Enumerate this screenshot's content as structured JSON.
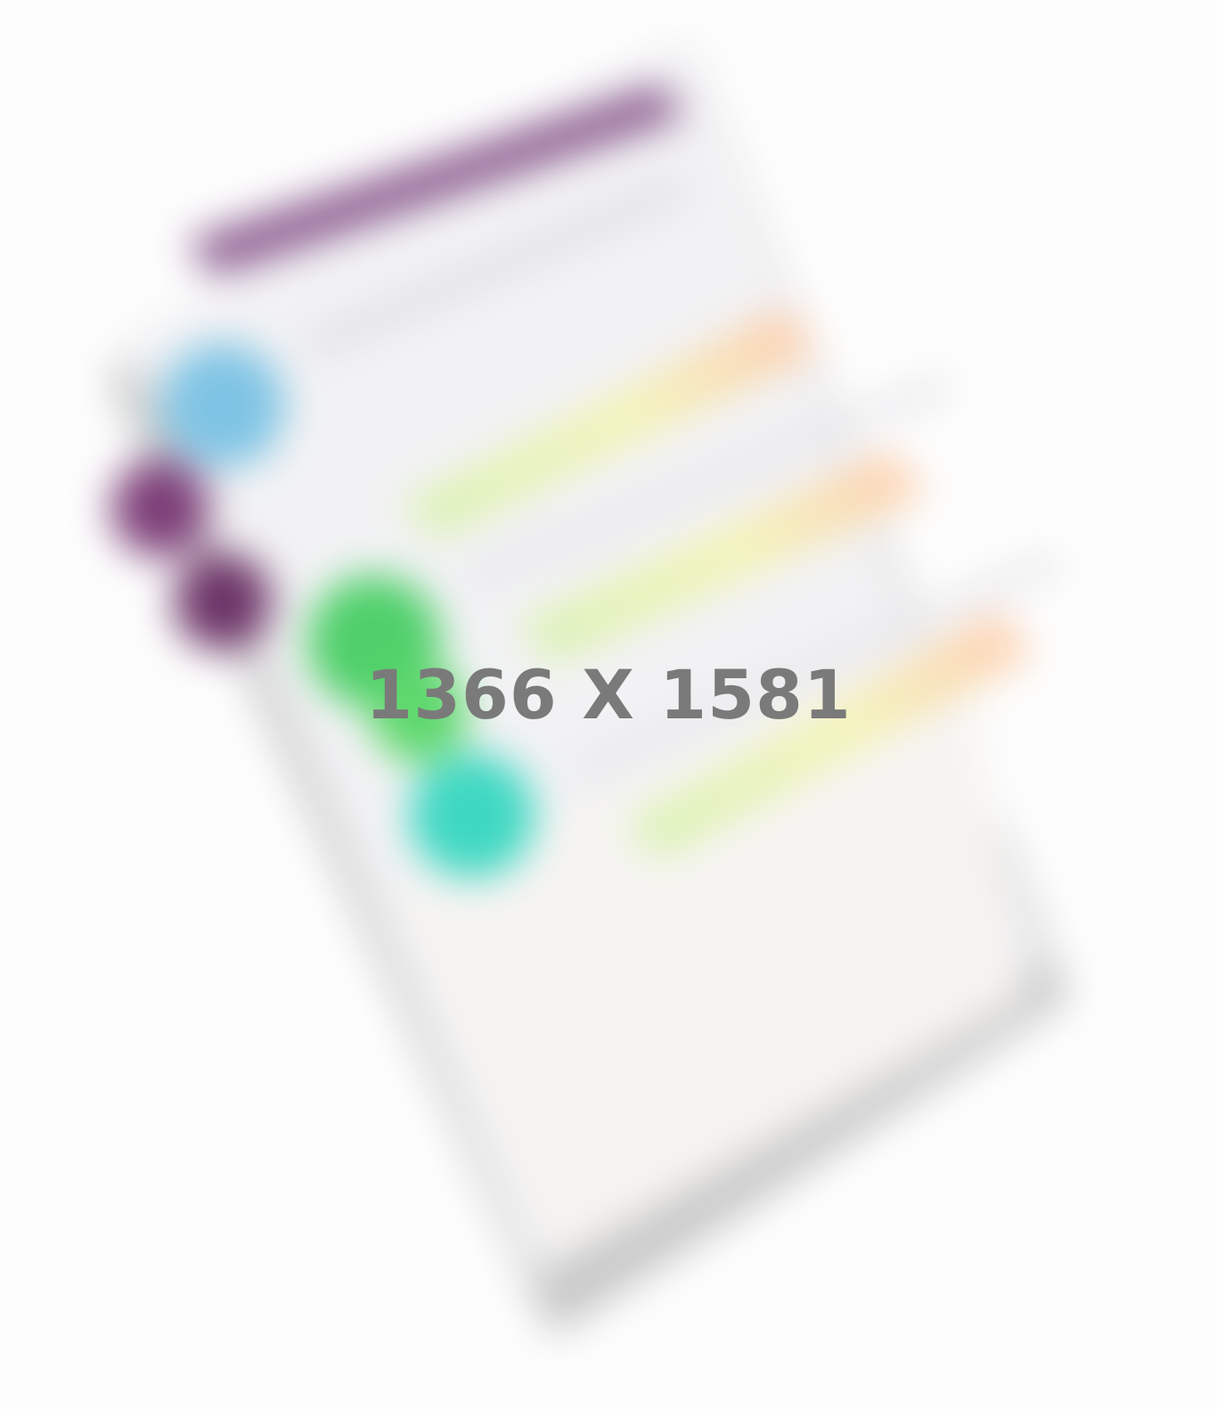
{
  "placeholder": {
    "label": "1366 X 1581",
    "label_color": "#7a7a7a"
  },
  "illustration": {
    "subject": "tilted-phone-mockup",
    "blurred": true,
    "colors": {
      "background": "#fdfdfd",
      "phone_shadow": "#9a9a9a",
      "header_bar": "#8a5a8e",
      "avatar_blue": "#7fc4e4",
      "avatar_purple": "#7d3f78",
      "avatar_green": "#4fd06a",
      "avatar_teal": "#3ed8c2",
      "gradient_start": "#d6f2b4",
      "gradient_mid": "#f4f4b8",
      "gradient_end": "#ffc8b0"
    },
    "gradient_bars": 3
  }
}
